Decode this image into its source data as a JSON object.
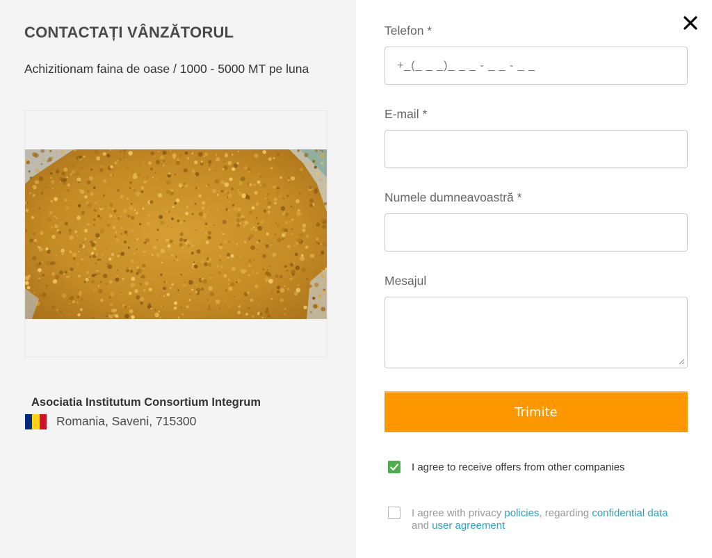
{
  "seller": {
    "title": "CONTACTAȚI VÂNZĂTORUL",
    "listing_title": "Achizitionam faina de oase / 1000 - 5000 MT pe luna",
    "company_name": "Asociatia Institutum Consortium Integrum",
    "location": "Romania, Saveni, 715300",
    "flag_colors": [
      "#002b7f",
      "#fcd116",
      "#ce1126"
    ]
  },
  "form": {
    "phone_label": "Telefon *",
    "phone_placeholder": "+_(_ _ _)_ _ _ - _ _ - _ _",
    "email_label": "E-mail *",
    "name_label": "Numele dumneavoastră *",
    "message_label": "Mesajul",
    "submit_label": "Trimite",
    "submit_color": "#fd9700"
  },
  "agreements": {
    "offers_text": "I agree to receive offers from other companies",
    "offers_checked": true,
    "privacy_text_1": "I agree with privacy ",
    "privacy_link_policies": "policies",
    "privacy_text_2": ", regarding ",
    "privacy_link_data": "confidential data",
    "privacy_text_3": " and ",
    "privacy_link_agreement": "user agreement",
    "privacy_checked": false,
    "link_color": "#2aa3c6"
  },
  "icons": {
    "close": "close-icon",
    "checkmark": "checkmark-icon",
    "flag": "romania-flag-icon"
  }
}
